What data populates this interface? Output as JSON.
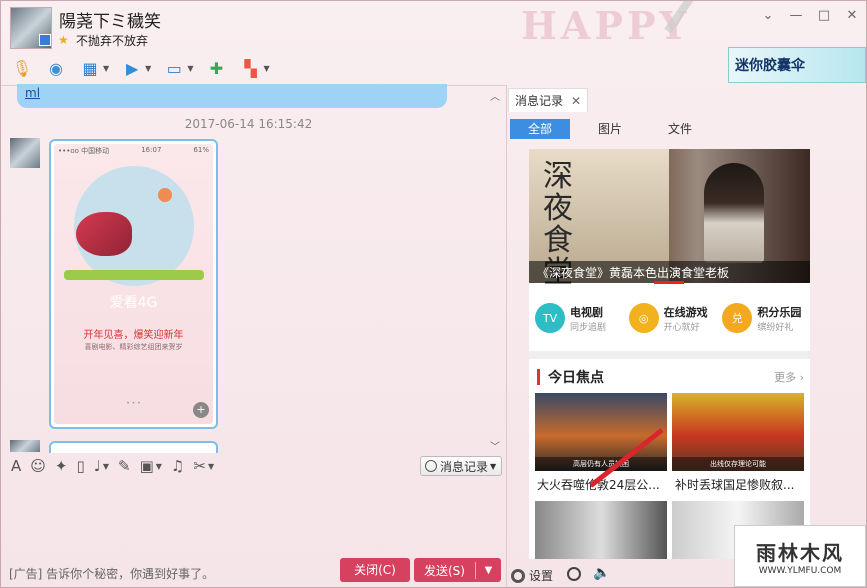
{
  "contact": {
    "name": "陽荛下ミ穢笑",
    "signature": "不抛弃不放弃"
  },
  "decor": {
    "happy_text": "HAPPY"
  },
  "ad_banner": {
    "text": "迷你胶囊伞"
  },
  "chat": {
    "prev_link": "ml",
    "timestamp": "2017-06-14 16:15:42",
    "image_card": {
      "carrier": "•••oo 中国移动",
      "time": "16:07",
      "battery": "61%",
      "big_text": "爱看4G",
      "promo": "开年见喜，爆笑迎新年",
      "promo_sub": "喜剧电影、精彩综艺组团来贺岁",
      "dots": "• • •"
    }
  },
  "input": {
    "history_label": "消息记录"
  },
  "bottom": {
    "ad_text": "[广告] 告诉你个秘密，你遇到好事了。",
    "close_label": "关闭(C)",
    "send_label": "发送(S)"
  },
  "right_panel": {
    "tab_label": "消息记录",
    "filters": [
      "全部",
      "图片",
      "文件"
    ],
    "hero": {
      "big_title": "深夜食堂",
      "caption": "《深夜食堂》黄磊本色出演食堂老板"
    },
    "categories": [
      {
        "icon": "TV",
        "title": "电视剧",
        "sub": "同步追剧",
        "color": "#2dbdc4"
      },
      {
        "icon": "◎",
        "title": "在线游戏",
        "sub": "开心就好",
        "color": "#f2b21f"
      },
      {
        "icon": "兑",
        "title": "积分乐园",
        "sub": "缤纷好礼",
        "color": "#f2a81f"
      }
    ],
    "focus": {
      "title": "今日焦点",
      "more": "更多"
    },
    "news": [
      {
        "caption": "高层仍有人员被困",
        "title": "大火吞噬伦敦24层公..."
      },
      {
        "caption": "出线仅存理论可能",
        "title": "补时丢球国足惨败叙..."
      }
    ],
    "footer": {
      "setting_label": "设置"
    }
  },
  "watermark": {
    "big": "雨林木风",
    "url": "WWW.YLMFU.COM"
  }
}
